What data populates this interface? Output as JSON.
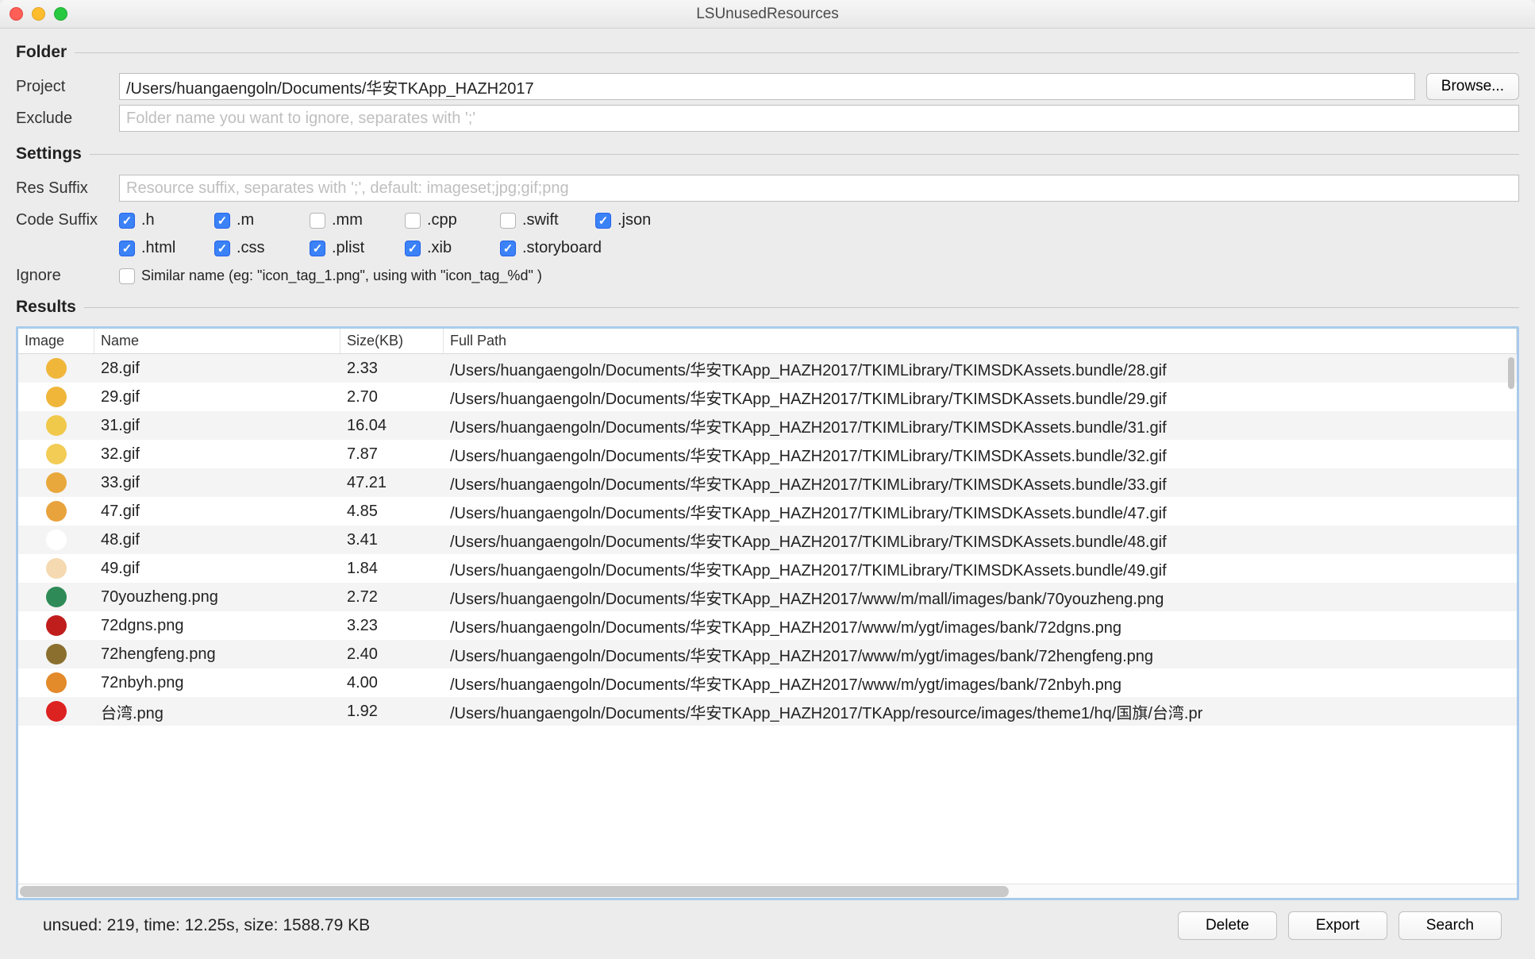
{
  "window": {
    "title": "LSUnusedResources"
  },
  "folder": {
    "legend": "Folder",
    "project_label": "Project",
    "project_value": "/Users/huangaengoln/Documents/华安TKApp_HAZH2017",
    "browse_label": "Browse...",
    "exclude_label": "Exclude",
    "exclude_placeholder": "Folder name you want to ignore, separates with ';'"
  },
  "settings": {
    "legend": "Settings",
    "res_suffix_label": "Res Suffix",
    "res_suffix_placeholder": "Resource suffix, separates with ';', default: imageset;jpg;gif;png",
    "code_suffix_label": "Code Suffix",
    "suffixes": [
      {
        "label": ".h",
        "checked": true
      },
      {
        "label": ".m",
        "checked": true
      },
      {
        "label": ".mm",
        "checked": false
      },
      {
        "label": ".cpp",
        "checked": false
      },
      {
        "label": ".swift",
        "checked": false
      },
      {
        "label": ".json",
        "checked": true
      },
      {
        "label": ".html",
        "checked": true
      },
      {
        "label": ".css",
        "checked": true
      },
      {
        "label": ".plist",
        "checked": true
      },
      {
        "label": ".xib",
        "checked": true
      },
      {
        "label": ".storyboard",
        "checked": true
      }
    ],
    "ignore_label": "Ignore",
    "ignore_checkbox_label": "Similar name (eg: \"icon_tag_1.png\", using with \"icon_tag_%d\" )",
    "ignore_checked": false
  },
  "results": {
    "legend": "Results",
    "headers": {
      "image": "Image",
      "name": "Name",
      "size": "Size(KB)",
      "path": "Full Path"
    },
    "rows": [
      {
        "icon_color": "#f0b63a",
        "name": "28.gif",
        "size": "2.33",
        "path": "/Users/huangaengoln/Documents/华安TKApp_HAZH2017/TKIMLibrary/TKIMSDKAssets.bundle/28.gif"
      },
      {
        "icon_color": "#f0b63a",
        "name": "29.gif",
        "size": "2.70",
        "path": "/Users/huangaengoln/Documents/华安TKApp_HAZH2017/TKIMLibrary/TKIMSDKAssets.bundle/29.gif"
      },
      {
        "icon_color": "#f0c84a",
        "name": "31.gif",
        "size": "16.04",
        "path": "/Users/huangaengoln/Documents/华安TKApp_HAZH2017/TKIMLibrary/TKIMSDKAssets.bundle/31.gif"
      },
      {
        "icon_color": "#f2cc55",
        "name": "32.gif",
        "size": "7.87",
        "path": "/Users/huangaengoln/Documents/华安TKApp_HAZH2017/TKIMLibrary/TKIMSDKAssets.bundle/32.gif"
      },
      {
        "icon_color": "#e9a83c",
        "name": "33.gif",
        "size": "47.21",
        "path": "/Users/huangaengoln/Documents/华安TKApp_HAZH2017/TKIMLibrary/TKIMSDKAssets.bundle/33.gif"
      },
      {
        "icon_color": "#e9a33c",
        "name": "47.gif",
        "size": "4.85",
        "path": "/Users/huangaengoln/Documents/华安TKApp_HAZH2017/TKIMLibrary/TKIMSDKAssets.bundle/47.gif"
      },
      {
        "icon_color": "#ffffff",
        "name": "48.gif",
        "size": "3.41",
        "path": "/Users/huangaengoln/Documents/华安TKApp_HAZH2017/TKIMLibrary/TKIMSDKAssets.bundle/48.gif"
      },
      {
        "icon_color": "#f5d9b0",
        "name": "49.gif",
        "size": "1.84",
        "path": "/Users/huangaengoln/Documents/华安TKApp_HAZH2017/TKIMLibrary/TKIMSDKAssets.bundle/49.gif"
      },
      {
        "icon_color": "#2e8b57",
        "name": "70youzheng.png",
        "size": "2.72",
        "path": "/Users/huangaengoln/Documents/华安TKApp_HAZH2017/www/m/mall/images/bank/70youzheng.png"
      },
      {
        "icon_color": "#c01d1d",
        "name": "72dgns.png",
        "size": "3.23",
        "path": "/Users/huangaengoln/Documents/华安TKApp_HAZH2017/www/m/ygt/images/bank/72dgns.png"
      },
      {
        "icon_color": "#8b6f2e",
        "name": "72hengfeng.png",
        "size": "2.40",
        "path": "/Users/huangaengoln/Documents/华安TKApp_HAZH2017/www/m/ygt/images/bank/72hengfeng.png"
      },
      {
        "icon_color": "#e38a2a",
        "name": "72nbyh.png",
        "size": "4.00",
        "path": "/Users/huangaengoln/Documents/华安TKApp_HAZH2017/www/m/ygt/images/bank/72nbyh.png"
      },
      {
        "icon_color": "#d22",
        "name": "台湾.png",
        "size": "1.92",
        "path": "/Users/huangaengoln/Documents/华安TKApp_HAZH2017/TKApp/resource/images/theme1/hq/国旗/台湾.pr"
      }
    ]
  },
  "footer": {
    "status": "unsued: 219, time: 12.25s, size: 1588.79 KB",
    "delete_label": "Delete",
    "export_label": "Export",
    "search_label": "Search"
  }
}
